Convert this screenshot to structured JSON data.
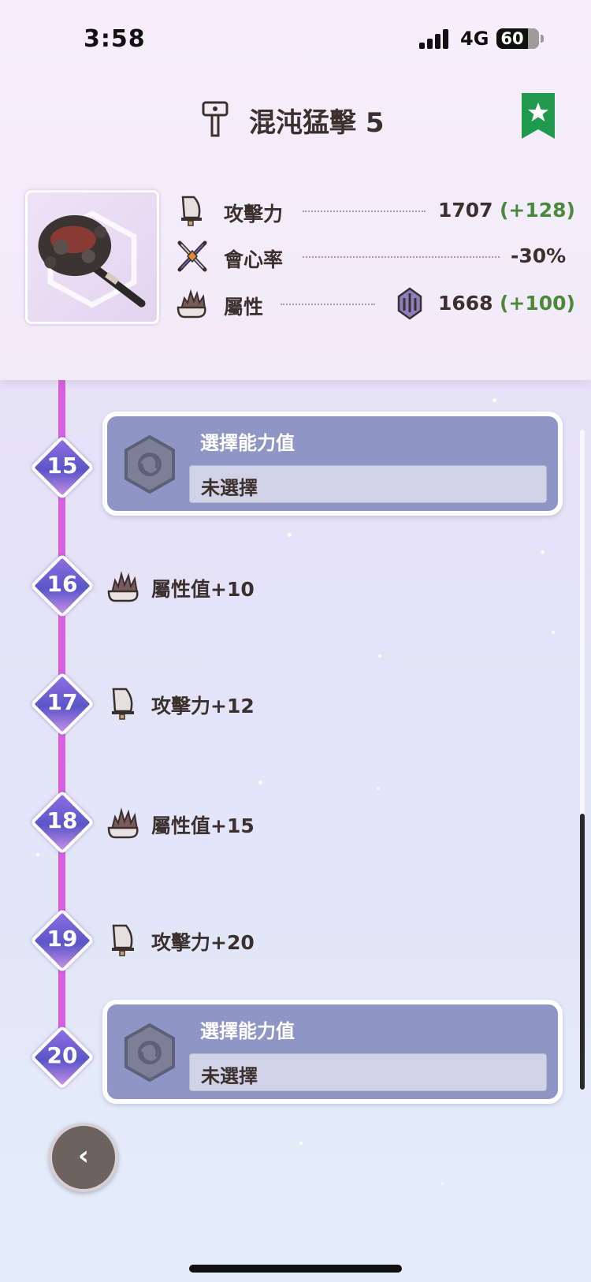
{
  "status_bar": {
    "time": "3:58",
    "network": "4G",
    "battery": "60"
  },
  "header": {
    "title": "混沌猛擊 5",
    "icon": "hammer-icon",
    "bookmark_icon": "star-bookmark-icon",
    "bookmark_color": "#1f9a4c"
  },
  "stats": {
    "attack": {
      "label": "攻擊力",
      "value": "1707",
      "bonus": "(+128)"
    },
    "affinity": {
      "label": "會心率",
      "value": "-30%"
    },
    "element": {
      "label": "屬性",
      "value": "1668",
      "bonus": "(+100)",
      "element_icon": "dragon-element-icon"
    }
  },
  "levels": [
    {
      "level": "15",
      "type": "choice",
      "title": "選擇能力值",
      "value": "未選擇"
    },
    {
      "level": "16",
      "type": "bonus",
      "icon": "element-flame-icon",
      "text": "屬性值+10"
    },
    {
      "level": "17",
      "type": "bonus",
      "icon": "attack-blade-icon",
      "text": "攻擊力+12"
    },
    {
      "level": "18",
      "type": "bonus",
      "icon": "element-flame-icon",
      "text": "屬性值+15"
    },
    {
      "level": "19",
      "type": "bonus",
      "icon": "attack-blade-icon",
      "text": "攻擊力+20"
    },
    {
      "level": "20",
      "type": "choice",
      "title": "選擇能力值",
      "value": "未選擇"
    }
  ],
  "colors": {
    "timeline": "#d85fe0",
    "bonus_green": "#4a8a3a",
    "card_bg": "#8f96c6"
  },
  "back_button": {
    "icon": "chevron-left-icon",
    "label": "‹"
  }
}
